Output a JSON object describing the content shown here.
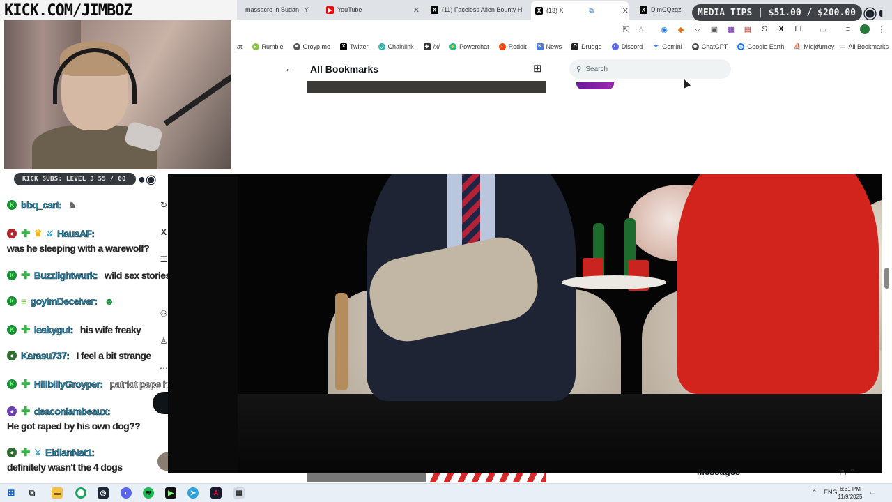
{
  "overlay": {
    "channel_url": "KICK.COM/JIMBOZ",
    "subs_label": "KICK SUBS: LEVEL 3 55 / 60",
    "media_tips": "MEDIA TIPS | $51.00 / $200.00"
  },
  "browser": {
    "tabs": [
      {
        "title": "massacre in Sudan - Y",
        "icon": "generic-tab-icon"
      },
      {
        "title": "YouTube",
        "icon": "youtube-icon"
      },
      {
        "title": "(11) Faceless Alien Bounty H",
        "icon": "x-logo-icon"
      },
      {
        "title": "(13) X",
        "icon": "x-logo-icon",
        "active": true
      },
      {
        "title": "DimCQzgz",
        "icon": "x-logo-icon"
      }
    ],
    "bookmarks": [
      {
        "label": "at",
        "icon": "none"
      },
      {
        "label": "Rumble",
        "icon": "rumble-icon"
      },
      {
        "label": "Groyp.me",
        "icon": "groyp-icon"
      },
      {
        "label": "Twitter",
        "icon": "x-logo-icon"
      },
      {
        "label": "Chainlink",
        "icon": "chainlink-icon"
      },
      {
        "label": "/x/",
        "icon": "clover-icon"
      },
      {
        "label": "Powerchat",
        "icon": "powerchat-icon"
      },
      {
        "label": "Reddit",
        "icon": "reddit-icon"
      },
      {
        "label": "News",
        "icon": "news-icon"
      },
      {
        "label": "Drudge",
        "icon": "drudge-icon"
      },
      {
        "label": "Discord",
        "icon": "discord-icon"
      },
      {
        "label": "Gemini",
        "icon": "gemini-icon"
      },
      {
        "label": "ChatGPT",
        "icon": "chatgpt-icon"
      },
      {
        "label": "Google Earth",
        "icon": "google-earth-icon"
      },
      {
        "label": "Midjourney",
        "icon": "midjourney-icon"
      }
    ],
    "all_bookmarks": "All Bookmarks"
  },
  "x_page": {
    "title": "All Bookmarks",
    "search_placeholder": "Search",
    "messages_label": "Messages"
  },
  "chat": {
    "messages": [
      {
        "user": "bbq_cart:",
        "text": "",
        "badges": [
          "kick"
        ]
      },
      {
        "user": "HausAF:",
        "text": "was he sleeping with a warewolf?",
        "badges": [
          "red",
          "plus",
          "crown",
          "sword"
        ]
      },
      {
        "user": "Buzzlightwurk:",
        "text": "wild sex stories",
        "badges": [
          "kick",
          "plus"
        ]
      },
      {
        "user": "goyimDeceiver:",
        "text": "",
        "badges": [
          "kick",
          "eq"
        ]
      },
      {
        "user": "leakygut:",
        "text": "his wife freaky",
        "badges": [
          "kick",
          "plus"
        ]
      },
      {
        "user": "Karasu737:",
        "text": "I feel a bit strange",
        "badges": [
          "o"
        ]
      },
      {
        "user": "HillbillyGroyper:",
        "text": "patriot pepe has claws",
        "badges": [
          "kick",
          "plus"
        ]
      },
      {
        "user": "deaconlambeaux:",
        "text": "He got raped by his own dog??",
        "badges": [
          "purple",
          "plus"
        ]
      },
      {
        "user": "EldianNat1:",
        "text": "definitely wasn't the 4 dogs",
        "badges": [
          "o",
          "plus",
          "sword"
        ]
      }
    ]
  },
  "taskbar": {
    "language": "ENG",
    "time": "6:31 PM",
    "date": "11/9/2025"
  },
  "colors": {
    "chat_username": "#2f8fb3",
    "overlay_pill": "#3f4247",
    "video_bg": "#0a0a0a"
  }
}
